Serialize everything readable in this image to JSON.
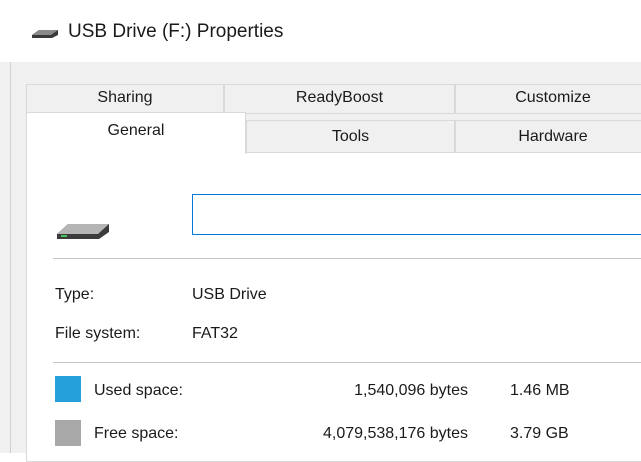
{
  "window": {
    "title": "USB Drive (F:) Properties",
    "title_icon": "usb-drive-icon"
  },
  "tabs": {
    "row_top": [
      {
        "label": "Sharing"
      },
      {
        "label": "ReadyBoost"
      },
      {
        "label": "Customize"
      }
    ],
    "row_bottom": [
      {
        "label": "General",
        "selected": true
      },
      {
        "label": "Tools"
      },
      {
        "label": "Hardware"
      }
    ]
  },
  "general": {
    "drive_icon": "usb-drive-icon",
    "volume_label_value": "",
    "type_label": "Type:",
    "type_value": "USB Drive",
    "fs_label": "File system:",
    "fs_value": "FAT32",
    "used": {
      "label": "Used space:",
      "bytes": "1,540,096 bytes",
      "size": "1.46 MB",
      "color": "#26a0da"
    },
    "free": {
      "label": "Free space:",
      "bytes": "4,079,538,176 bytes",
      "size": "3.79 GB",
      "color": "#a8a8a8"
    }
  }
}
